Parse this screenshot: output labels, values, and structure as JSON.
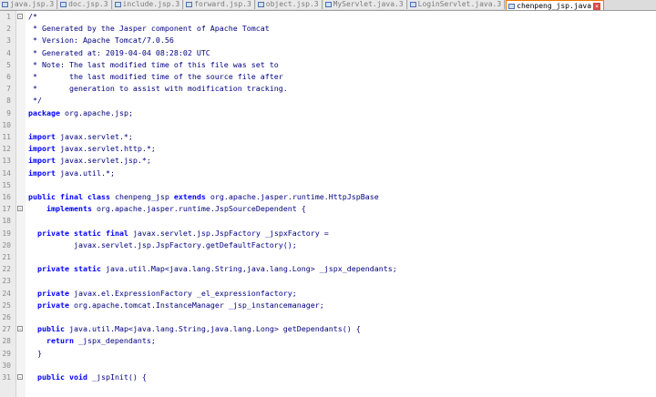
{
  "tabs": [
    {
      "label": "java.jsp.3",
      "active": false
    },
    {
      "label": "doc.jsp.3",
      "active": false
    },
    {
      "label": "include.jsp.3",
      "active": false
    },
    {
      "label": "forward.jsp.3",
      "active": false
    },
    {
      "label": "object.jsp.3",
      "active": false
    },
    {
      "label": "MyServlet.java.3",
      "active": false
    },
    {
      "label": "LoginServlet.java.3",
      "active": false
    },
    {
      "label": "chenpeng_jsp.java",
      "active": true
    }
  ],
  "lines": [
    {
      "n": "1",
      "text": "/*",
      "type": "comment",
      "fold": "-"
    },
    {
      "n": "2",
      "text": " * Generated by the Jasper component of Apache Tomcat",
      "type": "comment"
    },
    {
      "n": "3",
      "text": " * Version: Apache Tomcat/7.0.56",
      "type": "comment"
    },
    {
      "n": "4",
      "text": " * Generated at: 2019-04-04 08:28:02 UTC",
      "type": "comment"
    },
    {
      "n": "5",
      "text": " * Note: The last modified time of this file was set to",
      "type": "comment"
    },
    {
      "n": "6",
      "text": " *       the last modified time of the source file after",
      "type": "comment"
    },
    {
      "n": "7",
      "text": " *       generation to assist with modification tracking.",
      "type": "comment"
    },
    {
      "n": "8",
      "text": " */",
      "type": "comment"
    },
    {
      "n": "9",
      "text": "package org.apache.jsp;",
      "type": "code"
    },
    {
      "n": "10",
      "text": "",
      "type": "code"
    },
    {
      "n": "11",
      "text": "import javax.servlet.*;",
      "type": "code"
    },
    {
      "n": "12",
      "text": "import javax.servlet.http.*;",
      "type": "code"
    },
    {
      "n": "13",
      "text": "import javax.servlet.jsp.*;",
      "type": "code"
    },
    {
      "n": "14",
      "text": "import java.util.*;",
      "type": "code"
    },
    {
      "n": "15",
      "text": "",
      "type": "code"
    },
    {
      "n": "16",
      "text": "public final class chenpeng_jsp extends org.apache.jasper.runtime.HttpJspBase",
      "type": "code"
    },
    {
      "n": "17",
      "text": "    implements org.apache.jasper.runtime.JspSourceDependent {",
      "type": "code",
      "fold": "-"
    },
    {
      "n": "18",
      "text": "",
      "type": "code"
    },
    {
      "n": "19",
      "text": "  private static final javax.servlet.jsp.JspFactory _jspxFactory =",
      "type": "code"
    },
    {
      "n": "20",
      "text": "          javax.servlet.jsp.JspFactory.getDefaultFactory();",
      "type": "code"
    },
    {
      "n": "21",
      "text": "",
      "type": "code"
    },
    {
      "n": "22",
      "text": "  private static java.util.Map<java.lang.String,java.lang.Long> _jspx_dependants;",
      "type": "code"
    },
    {
      "n": "23",
      "text": "",
      "type": "code"
    },
    {
      "n": "24",
      "text": "  private javax.el.ExpressionFactory _el_expressionfactory;",
      "type": "code"
    },
    {
      "n": "25",
      "text": "  private org.apache.tomcat.InstanceManager _jsp_instancemanager;",
      "type": "code"
    },
    {
      "n": "26",
      "text": "",
      "type": "code"
    },
    {
      "n": "27",
      "text": "  public java.util.Map<java.lang.String,java.lang.Long> getDependants() {",
      "type": "code",
      "fold": "-"
    },
    {
      "n": "28",
      "text": "    return _jspx_dependants;",
      "type": "code"
    },
    {
      "n": "29",
      "text": "  }",
      "type": "code"
    },
    {
      "n": "30",
      "text": "",
      "type": "code"
    },
    {
      "n": "31",
      "text": "  public void _jspInit() {",
      "type": "code",
      "fold": "-"
    }
  ],
  "keywords": [
    "package",
    "import",
    "public",
    "final",
    "class",
    "extends",
    "implements",
    "private",
    "static",
    "return",
    "void"
  ]
}
